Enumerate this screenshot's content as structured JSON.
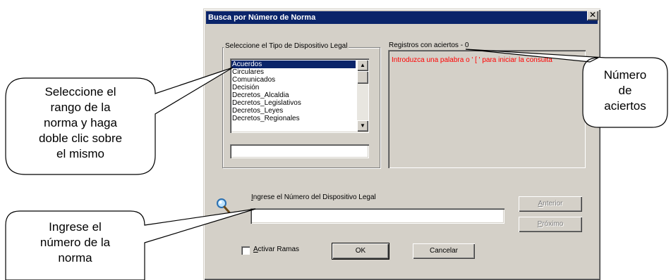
{
  "dialog": {
    "title": "Busca por Número de Norma",
    "close_glyph": "✕",
    "type_group_label": "Seleccione el Tipo de Dispositivo Legal",
    "types": [
      "Acuerdos",
      "Circulares",
      "Comunicados",
      "Decisión",
      "Decretos_Alcaldia",
      "Decretos_Legislativos",
      "Decretos_Leyes",
      "Decretos_Regionales"
    ],
    "selected_type": "Acuerdos",
    "type_filter_value": "",
    "results_label": "Registros con aciertos - 0",
    "results_hint": "Introduzca una palabra o ' [ ' para iniciar la consulta",
    "number_label": "Ingrese el Número del Dispositivo Legal",
    "number_value": "",
    "prev_button": "Anterior",
    "next_button": "Próximo",
    "activate_label": "Activar Ramas",
    "activate_checked": false,
    "ok_button": "OK",
    "cancel_button": "Cancelar"
  },
  "callouts": {
    "left_top": [
      "Seleccione el",
      "rango de la",
      "norma y haga",
      "doble clic sobre",
      "el mismo"
    ],
    "left_bottom": [
      "Ingrese el",
      "número de la",
      "norma"
    ],
    "right": [
      "Número",
      "de",
      "aciertos"
    ]
  }
}
